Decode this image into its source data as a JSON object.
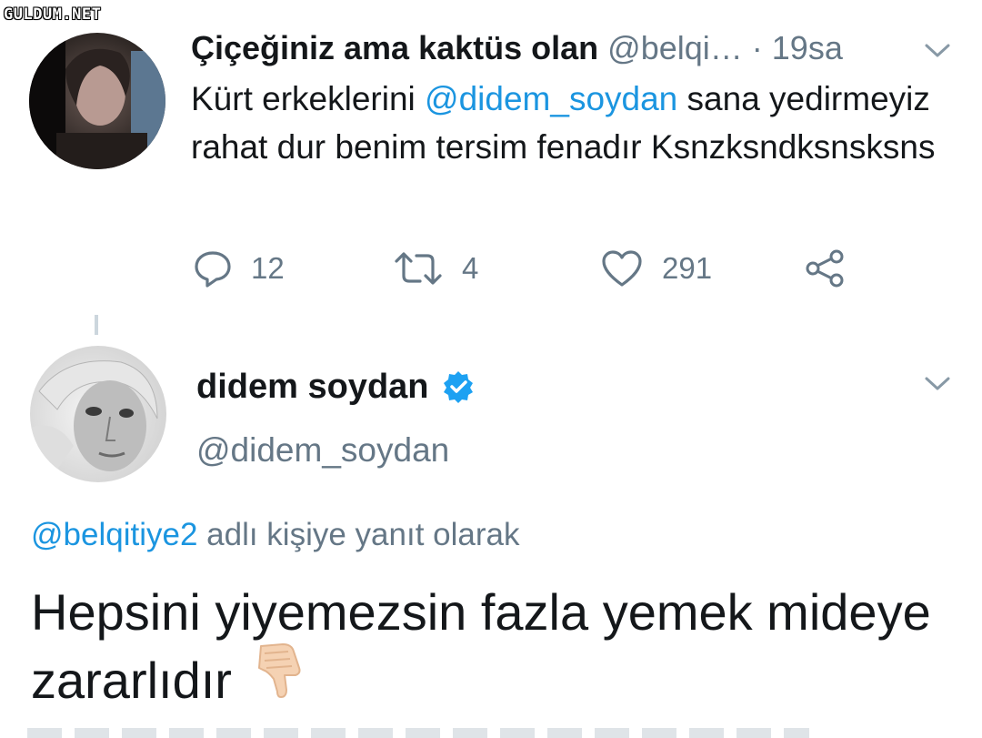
{
  "watermark": "GULDUM.NET",
  "tweet1": {
    "display_name": "Çiçeğiniz ama kaktüs olan",
    "handle": "@belqi…",
    "time": "· 19sa",
    "text_before": "Kürt erkeklerini ",
    "mention": "@didem_soydan",
    "text_after": "  sana yedirmeyiz rahat dur benim tersim fenadır Ksnzksndksnsksns",
    "replies": "12",
    "retweets": "4",
    "likes": "291",
    "icons": [
      "reply-icon",
      "retweet-icon",
      "heart-icon",
      "share-icon",
      "chevron-down-icon"
    ]
  },
  "tweet2": {
    "display_name": "didem soydan",
    "handle": "@didem_soydan",
    "reply_mention": "@belqitiye2",
    "reply_label": " adlı kişiye yanıt olarak",
    "text": "Hepsini yiyemezsin fazla yemek mideye zararlıdır",
    "emoji": "👎",
    "icons": [
      "verified-badge-icon",
      "chevron-down-icon",
      "thumbs-down-icon"
    ]
  },
  "colors": {
    "accent": "#1b95e0",
    "muted": "#657786",
    "text": "#14171a",
    "verified": "#1da1f2"
  }
}
